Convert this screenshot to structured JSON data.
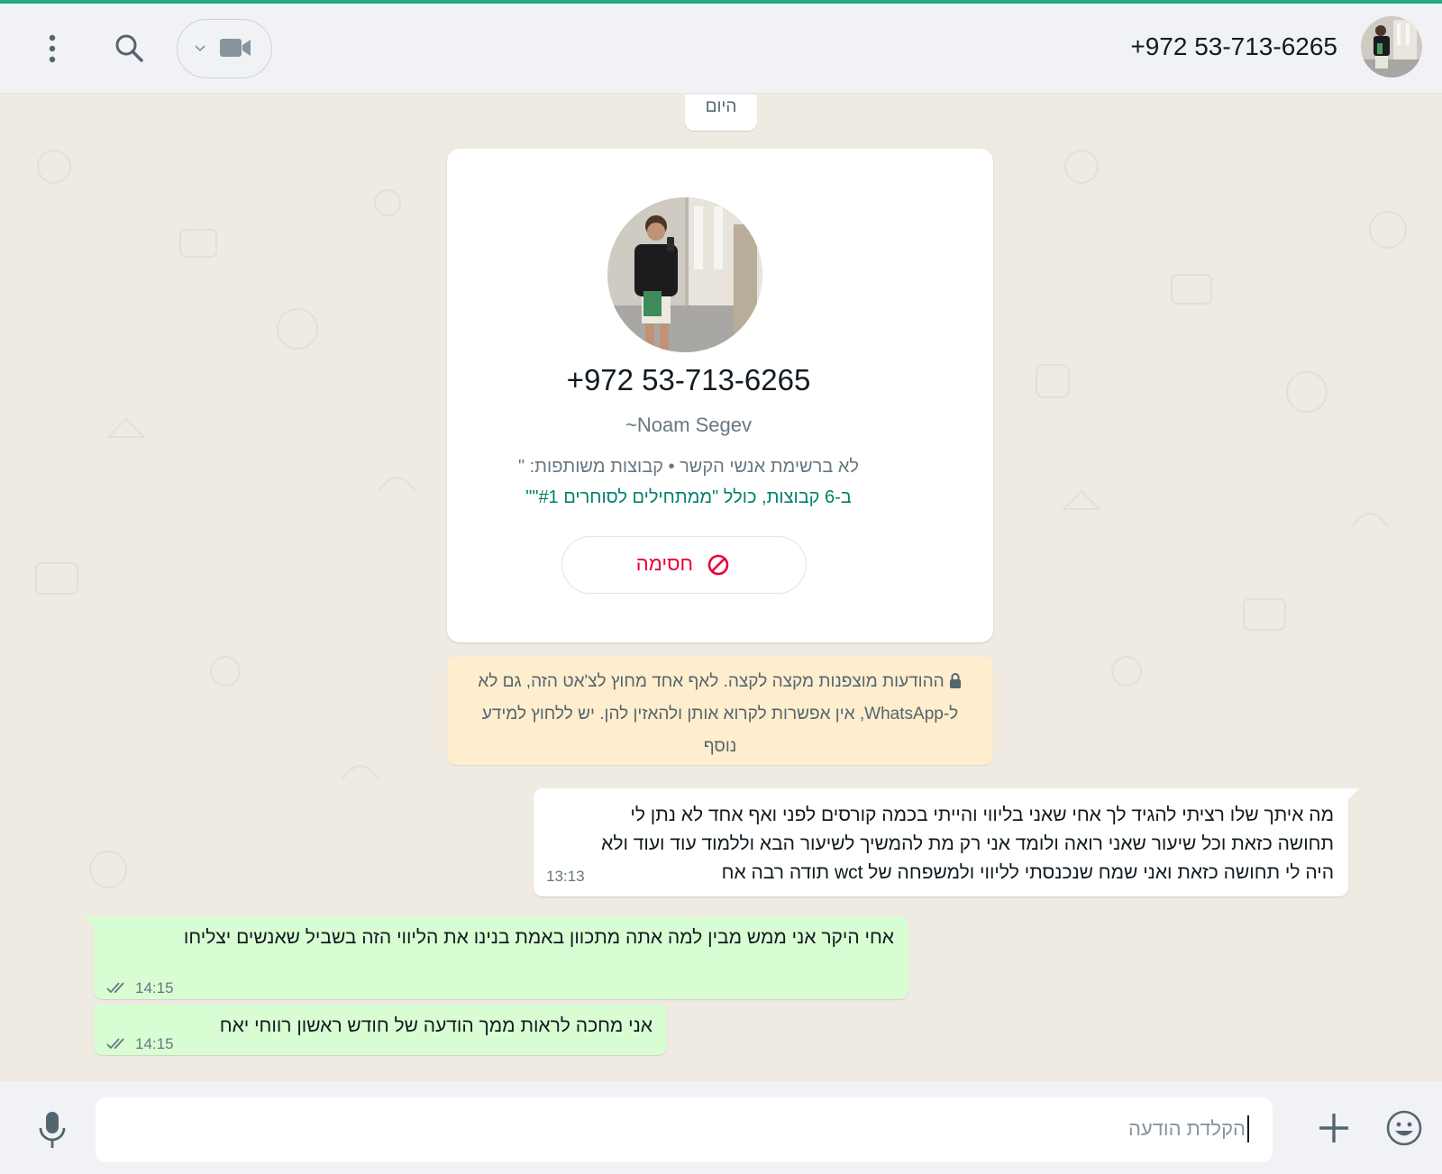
{
  "colors": {
    "accent": "#25a87a",
    "outgoing_bubble": "#d9fdd3",
    "incoming_bubble": "#ffffff",
    "encryption_notice": "#ffeecd",
    "block_red": "#ea0038",
    "group_link_green": "#008069",
    "chat_background": "#efeae2"
  },
  "header": {
    "contact_name": "+972 53-713-6265",
    "icons": [
      "avatar",
      "video-call-icon",
      "chevron-down-icon",
      "search-icon",
      "menu-icon"
    ]
  },
  "chat": {
    "date_chip": "היום",
    "profile_card": {
      "phone": "+972 53-713-6265",
      "pushname": "~Noam Segev",
      "info": "לא ברשימת אנשי הקשר • קבוצות משותפות: \"",
      "groups": "ב-6 קבוצות, כולל \"ממתחילים לסוחרים #1\"\"",
      "block_label": "חסימה"
    },
    "encryption_notice": "ההודעות מוצפנות מקצה לקצה. לאף אחד מחוץ לצ'אט הזה, גם לא ל-WhatsApp, אין אפשרות לקרוא אותן ולהאזין להן. יש ללחוץ למידע נוסף",
    "messages": [
      {
        "direction": "incoming",
        "lines": [
          "מה איתך שלו רציתי להגיד לך אחי שאני בליווי והייתי בכמה קורסים לפני ואף אחד לא נתן לי",
          "תחושה כזאת וכל שיעור שאני רואה ולומד אני רק מת להמשיך לשיעור הבא וללמוד עוד ועוד ולא",
          "היה לי תחושה כזאת ואני שמח שנכנסתי לליווי ולמשפחה של wct תודה רבה אח"
        ],
        "time": "13:13"
      },
      {
        "direction": "outgoing",
        "text": "אחי היקר אני ממש מבין למה אתה מתכוון באמת בנינו את הליווי הזה בשביל שאנשים יצליחו",
        "time": "14:15",
        "status": "read"
      },
      {
        "direction": "outgoing",
        "text": "אני מחכה לראות ממך הודעה של חודש ראשון רווחי יאח",
        "time": "14:15",
        "status": "read"
      }
    ]
  },
  "composer": {
    "placeholder": "הקלדת הודעה",
    "icons": [
      "emoji-icon",
      "plus-icon",
      "mic-icon"
    ]
  }
}
